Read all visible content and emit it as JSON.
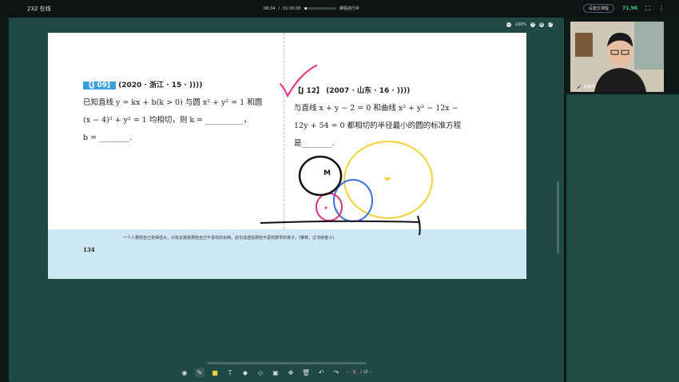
{
  "top": {
    "online_count": "232 在线",
    "time_elapsed": "08:34",
    "time_total": "01:30:00",
    "time_separator": "/",
    "progress_fraction": 0.095,
    "status": "课程进行中",
    "window_btn": "设置文课程",
    "signal": "71.9K"
  },
  "zoom": {
    "level": "100%"
  },
  "question_left": {
    "tag": "【J 09】",
    "meta": "(2020 · 浙江 · 15 ·",
    "line1": "已知直线 y = kx + b(k > 0) 与圆 x² + y² = 1 和圆",
    "line2": "(x − 4)² + y² = 1 均相切，则 k = __________，",
    "line3": "b = ________."
  },
  "question_right": {
    "tag": "【J 12】",
    "meta": "(2007 · 山东 · 16 ·",
    "line1": "与直线 x + y − 2 = 0 和曲线 x² + y² − 12x −",
    "line2": "12y + 54 = 0 都相切的半径最小的圆的标准方程",
    "line3": "是________."
  },
  "footer": {
    "quote": "一个人要想自己变得强大，只有去接受那些自己不喜欢的东西。此句话送给那些不喜欢数学的孩子。(推荐，过书徐奋斗)",
    "page_number": "134"
  },
  "annotation": {
    "label_m": "M"
  },
  "toolbar": {
    "page_current": "1",
    "page_total": "/ 10"
  },
  "teacher": {
    "name": "宋昊明"
  }
}
